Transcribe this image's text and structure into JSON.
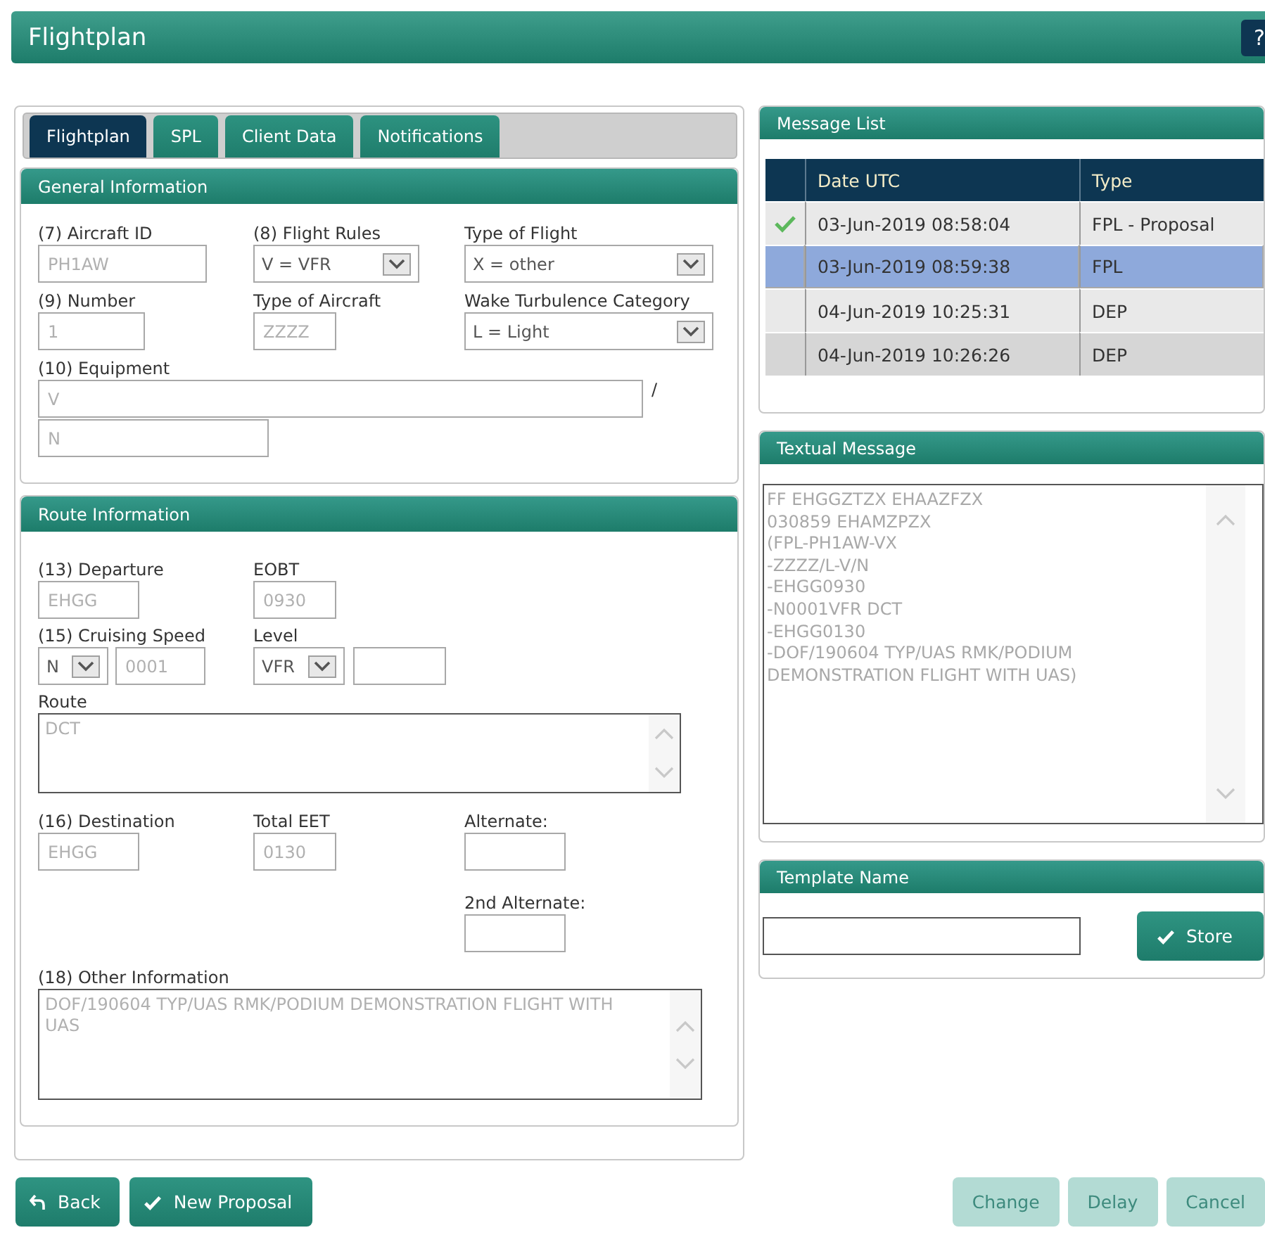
{
  "window": {
    "title": "Flightplan",
    "help_button": "?"
  },
  "tabs": [
    {
      "label": "Flightplan",
      "selected": true
    },
    {
      "label": "SPL",
      "selected": false
    },
    {
      "label": "Client Data",
      "selected": false
    },
    {
      "label": "Notifications",
      "selected": false
    }
  ],
  "general_information": {
    "title": "General Information",
    "aircraft_id": {
      "label": "(7) Aircraft ID",
      "value": "PH1AW"
    },
    "flight_rules": {
      "label": "(8) Flight Rules",
      "value": "V = VFR"
    },
    "type_of_flight": {
      "label": "Type of Flight",
      "value": "X = other"
    },
    "number": {
      "label": "(9) Number",
      "value": "1"
    },
    "type_of_aircraft": {
      "label": "Type of Aircraft",
      "value": "ZZZZ"
    },
    "wake_turbulence_category": {
      "label": "Wake Turbulence Category",
      "value": "L = Light"
    },
    "equipment": {
      "label": "(10) Equipment",
      "value": "V",
      "separator": "/",
      "second_value": "N"
    }
  },
  "route_information": {
    "title": "Route Information",
    "departure": {
      "label": "(13) Departure",
      "value": "EHGG"
    },
    "eobt": {
      "label": "EOBT",
      "value": "0930"
    },
    "cruising_speed": {
      "label": "(15) Cruising Speed",
      "unit": "N",
      "value": "0001"
    },
    "level": {
      "label": "Level",
      "unit": "VFR"
    },
    "route": {
      "label": "Route",
      "value": "DCT"
    },
    "destination": {
      "label": "(16) Destination",
      "value": "EHGG"
    },
    "total_eet": {
      "label": "Total EET",
      "value": "0130"
    },
    "alternate": {
      "label": "Alternate:"
    },
    "second_alternate": {
      "label": "2nd Alternate:"
    },
    "other_information": {
      "label": "(18) Other Information",
      "value": "DOF/190604 TYP/UAS RMK/PODIUM DEMONSTRATION FLIGHT WITH UAS"
    }
  },
  "message_list": {
    "title": "Message List",
    "columns": [
      "Date UTC",
      "Type"
    ],
    "rows": [
      {
        "date": "03-Jun-2019 08:58:04",
        "type": "FPL - Proposal",
        "checked": true,
        "selected": false
      },
      {
        "date": "03-Jun-2019 08:59:38",
        "type": "FPL",
        "checked": false,
        "selected": true
      },
      {
        "date": "04-Jun-2019 10:25:31",
        "type": "DEP",
        "checked": false,
        "selected": false
      },
      {
        "date": "04-Jun-2019 10:26:26",
        "type": "DEP",
        "checked": false,
        "selected": false
      }
    ]
  },
  "textual_message": {
    "title": "Textual Message",
    "lines": [
      "FF EHGGZTZX EHAAZFZX",
      "030859 EHAMZPZX",
      "(FPL-PH1AW-VX",
      "-ZZZZ/L-V/N",
      "-EHGG0930",
      "-N0001VFR DCT",
      "-EHGG0130",
      "-DOF/190604 TYP/UAS RMK/PODIUM",
      "DEMONSTRATION FLIGHT WITH UAS)"
    ]
  },
  "template_name": {
    "title": "Template Name",
    "button": "Store"
  },
  "left_buttons": [
    {
      "label": "Back",
      "kind": "back",
      "disabled": false
    },
    {
      "label": "New Proposal",
      "kind": "confirm",
      "disabled": false
    }
  ],
  "right_buttons": [
    {
      "label": "Change",
      "kind": "plain",
      "disabled": true
    },
    {
      "label": "Delay",
      "kind": "plain",
      "disabled": true
    },
    {
      "label": "Cancel",
      "kind": "plain",
      "disabled": true
    }
  ]
}
